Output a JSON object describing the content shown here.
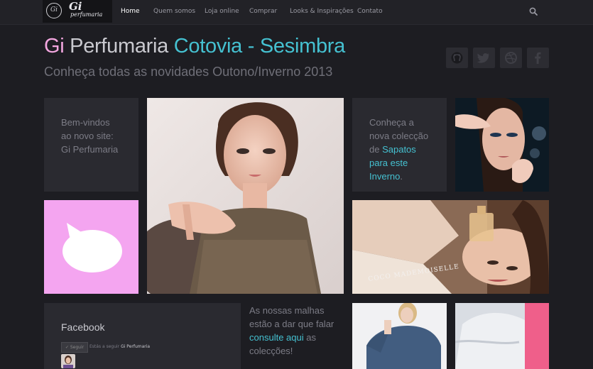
{
  "nav": {
    "logo_mark": "Gi",
    "logo_text": "Gi",
    "logo_sub": "perfumaria",
    "items": [
      {
        "label": "Home",
        "active": true
      },
      {
        "label": "Quem somos"
      },
      {
        "label": "Loja online"
      },
      {
        "label": "Comprar"
      },
      {
        "label": "Looks & Inspirações"
      },
      {
        "label": "Contato"
      }
    ],
    "search_icon": "search-icon"
  },
  "header": {
    "title_part1": "Gi",
    "title_part2": "Perfumaria",
    "title_part3": "Cotovia - Sesimbra",
    "subtitle": "Conheça todas as novidades Outono/Inverno 2013"
  },
  "social": [
    "github-icon",
    "twitter-icon",
    "dribbble-icon",
    "facebook-icon"
  ],
  "tiles": {
    "welcome": {
      "line1": "Bem-vindos",
      "line2": "ao novo site:",
      "line3": "Gi Perfumaria"
    },
    "shoes": {
      "line1": "Conheça a",
      "line2": "nova colecção",
      "line3_pre": "de ",
      "line3_link": "Sapatos",
      "line4_link": "para este",
      "line5_link": "Inverno",
      "line5_post": "."
    },
    "speech_icon": "speech-bubble-icon",
    "perfume_caption": "COCO MADEMOISELLE"
  },
  "facebook": {
    "title": "Facebook",
    "button": "✓ Seguir",
    "text_pre": "Estás a seguir",
    "text_name": "Gi Perfumaria"
  },
  "knitwear": {
    "line1": "As nossas malhas",
    "line2": "estão a dar que falar",
    "link": "consulte aqui",
    "post": " as",
    "line4": "colecções!"
  },
  "colors": {
    "accent": "#45c1d1",
    "pink": "#f2a6df",
    "background": "#1d1d22",
    "tile": "#2a2a30"
  }
}
